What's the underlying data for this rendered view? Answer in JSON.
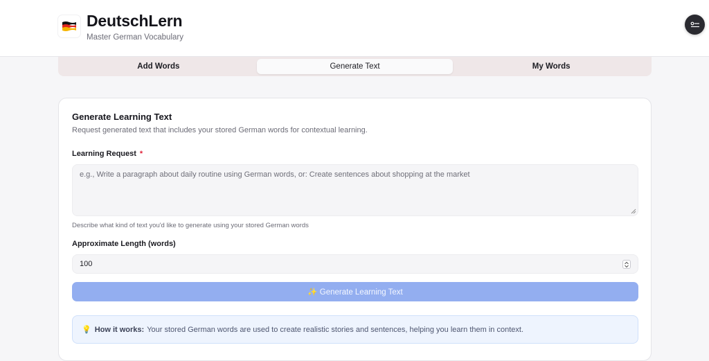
{
  "header": {
    "title": "DeutschLern",
    "subtitle": "Master German Vocabulary",
    "logo_icon": "german-flag-icon",
    "settings_icon": "toggle-settings-icon"
  },
  "tabs": [
    {
      "label": "Add Words",
      "active": false
    },
    {
      "label": "Generate Text",
      "active": true
    },
    {
      "label": "My Words",
      "active": false
    }
  ],
  "card": {
    "title": "Generate Learning Text",
    "description": "Request generated text that includes your stored German words for contextual learning.",
    "request_label": "Learning Request",
    "required_mark": "*",
    "request_placeholder": "e.g., Write a paragraph about daily routine using German words, or: Create sentences about shopping at the market",
    "request_hint": "Describe what kind of text you'd like to generate using your stored German words",
    "length_label": "Approximate Length (words)",
    "length_value": "100",
    "generate_button": "✨ Generate Learning Text",
    "info_icon": "💡",
    "info_title": "How it works:",
    "info_text": "Your stored German words are used to create realistic stories and sentences, helping you learn them in context."
  },
  "colors": {
    "accent_button": "#93aef0",
    "tab_bar": "#efe7e8",
    "info_bg": "#eef4fe",
    "required": "#e0243a"
  }
}
